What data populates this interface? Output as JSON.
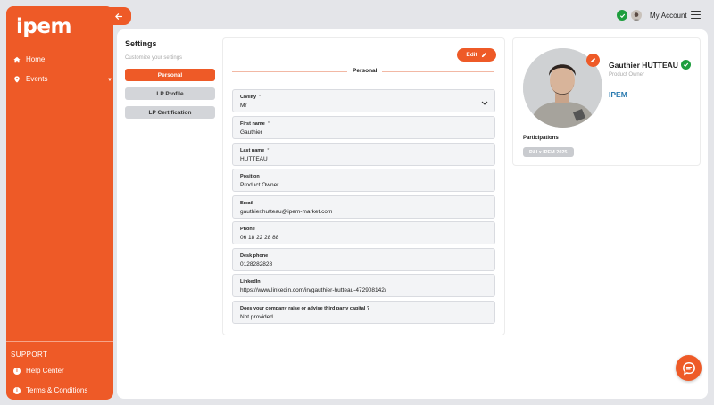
{
  "app": {
    "logo_text": "ipem"
  },
  "sidebar": {
    "items": [
      {
        "label": "Home",
        "icon": "home-icon"
      },
      {
        "label": "Events",
        "icon": "location-pin-icon"
      }
    ],
    "support_title": "SUPPORT",
    "support_items": [
      {
        "label": "Help Center",
        "icon": "info-icon"
      },
      {
        "label": "Terms & Conditions",
        "icon": "info-icon"
      }
    ]
  },
  "header": {
    "account_prefix": "My",
    "account_sep": "|",
    "account_label": "Account"
  },
  "settings": {
    "title": "Settings",
    "subtitle": "Customize your settings",
    "menu": [
      {
        "label": "Personal",
        "active": true
      },
      {
        "label": "LP Profile",
        "active": false
      },
      {
        "label": "LP Certification",
        "active": false
      }
    ]
  },
  "form": {
    "edit_label": "Edit",
    "section_title": "Personal",
    "fields": {
      "civility": {
        "label": "Civility",
        "required": "*",
        "value": "Mr"
      },
      "first_name": {
        "label": "First name",
        "required": "*",
        "value": "Gauthier"
      },
      "last_name": {
        "label": "Last name",
        "required": "*",
        "value": "HUTTEAU"
      },
      "position": {
        "label": "Position",
        "value": "Product Owner"
      },
      "email": {
        "label": "Email",
        "value": "gauthier.hutteau@ipem-market.com"
      },
      "phone": {
        "label": "Phone",
        "value": "06 18 22 28 88"
      },
      "desk_phone": {
        "label": "Desk phone",
        "value": "0128282828"
      },
      "linkedin": {
        "label": "LinkedIn",
        "value": "https://www.linkedin.com/in/gauthier-hutteau-472908142/"
      },
      "capital": {
        "label": "Does your company raise or advise third party capital ?",
        "value": "Not provided"
      }
    }
  },
  "profile": {
    "name": "Gauthier HUTTEAU",
    "role": "Product Owner",
    "company": "IPEM",
    "participations_title": "Participations",
    "participations": [
      "P&I x IPEM 2025"
    ]
  },
  "colors": {
    "accent": "#ee5a27",
    "verified": "#1e9e3e",
    "company": "#2a7ab0"
  }
}
